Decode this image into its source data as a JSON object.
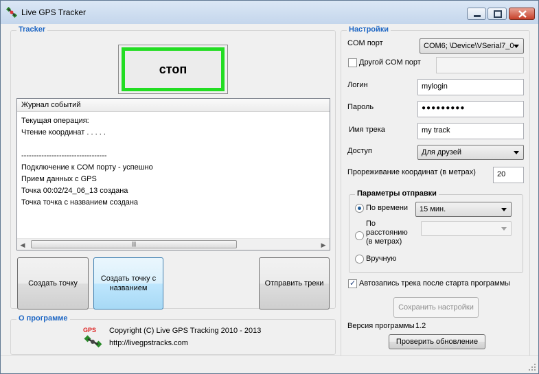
{
  "window": {
    "title": "Live GPS Tracker",
    "icon": "satellite-icon"
  },
  "tracker": {
    "title": "Tracker",
    "stop_label": "стоп",
    "log": {
      "header": "Журнал событий",
      "lines": [
        "Текущая операция:",
        "Чтение координат  . . . . .",
        "",
        "----------------------------------",
        "Подключение к COM порту - успешно",
        "Прием данных с GPS",
        "Точка 00:02/24_06_13 создана",
        "Точка точка с названием создана"
      ]
    },
    "buttons": {
      "create_point": "Создать точку",
      "create_named_point": "Создать точку с названием",
      "send_tracks": "Отправить треки"
    }
  },
  "settings": {
    "title": "Настройки",
    "com_port_label": "COM порт",
    "com_port_value": "COM6; \\Device\\VSerial7_0",
    "other_com_label": "Другой COM порт",
    "other_com_checked": false,
    "login_label": "Логин",
    "login_value": "mylogin",
    "password_label": "Пароль",
    "password_value": "●●●●●●●●●",
    "track_name_label": "Имя трека",
    "track_name_value": "my track",
    "access_label": "Доступ",
    "access_value": "Для друзей",
    "thinning_label": "Прореживание координат (в метрах)",
    "thinning_value": "20",
    "send_params": {
      "title": "Параметры отправки",
      "by_time_label": "По времени",
      "by_time_value": "15 мин.",
      "by_distance_label": "По расстоянию (в метрах)",
      "by_distance_value": "",
      "manual_label": "Вручную",
      "selected": "by_time"
    },
    "autostart_label": "Автозапись трека после старта программы",
    "autostart_checked": true,
    "save_button": "Сохранить настройки",
    "version_label": "Версия программы",
    "version_value": "1.2",
    "check_update_button": "Проверить обновление"
  },
  "about": {
    "title": "О программе",
    "copyright": "Copyright (C) Live GPS Tracking 2010 - 2013",
    "url": "http://livegpstracks.com",
    "logo_text": "GPS"
  },
  "colors": {
    "group_title": "#1f67c4",
    "stop_border": "#22dd22"
  }
}
